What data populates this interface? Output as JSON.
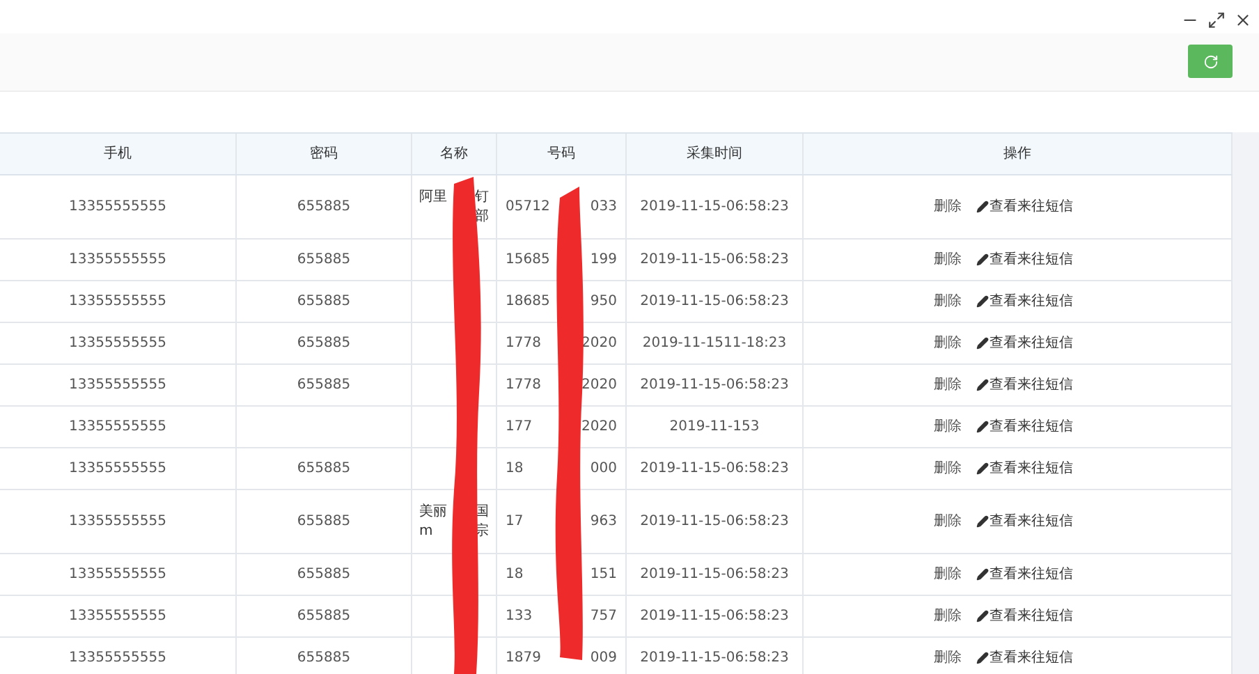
{
  "table": {
    "columns": [
      "手机",
      "密码",
      "名称",
      "号码",
      "采集时间",
      "操作"
    ],
    "rows": [
      {
        "phone": "13355555555",
        "password": "655885",
        "name": [
          [
            "阿里",
            "钉"
          ],
          [
            "部"
          ]
        ],
        "number": [
          "05712",
          "033"
        ],
        "time": "2019-11-15-06:58:23",
        "actions": [
          "删除",
          "查看来往短信"
        ]
      },
      {
        "phone": "13355555555",
        "password": "655885",
        "name": [],
        "number": [
          "15685",
          "199"
        ],
        "time": "2019-11-15-06:58:23",
        "actions": [
          "删除",
          "查看来往短信"
        ]
      },
      {
        "phone": "13355555555",
        "password": "655885",
        "name": [],
        "number": [
          "18685",
          "950"
        ],
        "time": "2019-11-15-06:58:23",
        "actions": [
          "删除",
          "查看来往短信"
        ]
      },
      {
        "phone": "13355555555",
        "password": "655885",
        "name": [],
        "number": [
          "1778",
          "2020"
        ],
        "time": "2019-11-1511-18:23",
        "actions": [
          "删除",
          "查看来往短信"
        ]
      },
      {
        "phone": "13355555555",
        "password": "655885",
        "name": [],
        "number": [
          "1778",
          "2020"
        ],
        "time": "2019-11-15-06:58:23",
        "actions": [
          "删除",
          "查看来往短信"
        ]
      },
      {
        "phone": "13355555555",
        "name": [],
        "number": [
          "177",
          "2020"
        ],
        "time": "2019-11-153",
        "actions": [
          "删除",
          "查看来往短信"
        ]
      },
      {
        "phone": "13355555555",
        "password": "655885",
        "name": [],
        "number": [
          "18",
          "000"
        ],
        "time": "2019-11-15-06:58:23",
        "actions": [
          "删除",
          "查看来往短信"
        ]
      },
      {
        "phone": "13355555555",
        "password": "655885",
        "name": [
          [
            "美丽",
            "国"
          ],
          [
            "m",
            "宗"
          ]
        ],
        "number": [
          "17",
          "963"
        ],
        "time": "2019-11-15-06:58:23",
        "actions": [
          "删除",
          "查看来往短信"
        ]
      },
      {
        "phone": "13355555555",
        "password": "655885",
        "name": [],
        "number": [
          "18",
          "151"
        ],
        "time": "2019-11-15-06:58:23",
        "actions": [
          "删除",
          "查看来往短信"
        ]
      },
      {
        "phone": "13355555555",
        "password": "655885",
        "name": [],
        "number": [
          "133",
          "757"
        ],
        "time": "2019-11-15-06:58:23",
        "actions": [
          "删除",
          "查看来往短信"
        ]
      },
      {
        "phone": "13355555555",
        "password": "655885",
        "name": [],
        "number": [
          "1879",
          "009"
        ],
        "time": "2019-11-15-06:58:23",
        "actions": [
          "删除",
          "查看来往短信"
        ]
      }
    ]
  }
}
